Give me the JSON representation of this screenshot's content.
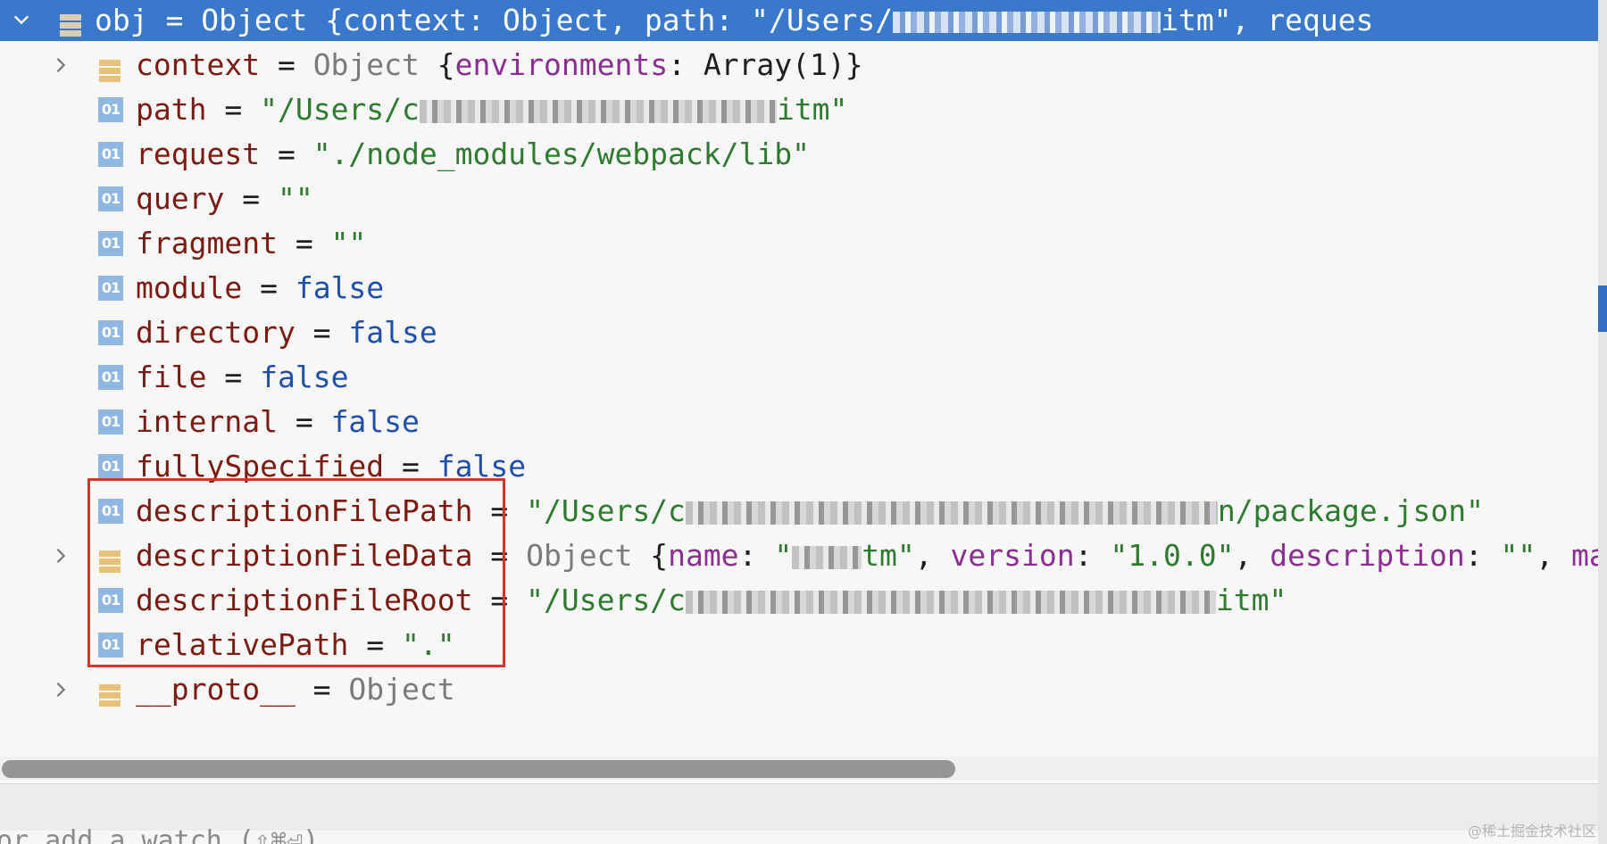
{
  "header": {
    "name": "obj",
    "eq": " = ",
    "type": "Object",
    "preview_start": " {context: Object, path: \"/Users/",
    "preview_end": "itm\", reques"
  },
  "rows": {
    "context": {
      "name": "context",
      "eq": " = ",
      "type": "Object",
      "preview_open": " {",
      "key": "environments",
      "rest": ": Array(1)}"
    },
    "path": {
      "name": "path",
      "eq": " = ",
      "value_start": "\"/Users/c",
      "value_end": "itm\""
    },
    "request": {
      "name": "request",
      "eq": " = ",
      "value": "\"./node_modules/webpack/lib\""
    },
    "query": {
      "name": "query",
      "eq": " = ",
      "value": "\"\""
    },
    "fragment": {
      "name": "fragment",
      "eq": " = ",
      "value": "\"\""
    },
    "module": {
      "name": "module",
      "eq": " = ",
      "value": "false"
    },
    "directory": {
      "name": "directory",
      "eq": " = ",
      "value": "false"
    },
    "file": {
      "name": "file",
      "eq": " = ",
      "value": "false"
    },
    "internal": {
      "name": "internal",
      "eq": " = ",
      "value": "false"
    },
    "fullySpecified": {
      "name": "fullySpecified",
      "eq": " = ",
      "value": "false"
    },
    "descriptionFilePath": {
      "name": "descriptionFilePath",
      "eq": " = ",
      "value_start": "\"/Users/c",
      "value_end": "n/package.json\""
    },
    "descriptionFileData": {
      "name": "descriptionFileData",
      "eq": " = ",
      "type": "Object",
      "open": " {",
      "k1": "name",
      "c1": ": ",
      "v1_start": "\"",
      "v1_end": "tm\"",
      "sep1": ", ",
      "k2": "version",
      "c2": ": ",
      "v2": "\"1.0.0\"",
      "sep2": ", ",
      "k3": "description",
      "c3": ": ",
      "v3": "\"\"",
      "sep3": ", ",
      "k4": "main"
    },
    "descriptionFileRoot": {
      "name": "descriptionFileRoot",
      "eq": " = ",
      "value_start": "\"/Users/c",
      "value_end": "itm\""
    },
    "relativePath": {
      "name": "relativePath",
      "eq": " = ",
      "value": "\".\""
    },
    "proto": {
      "name": "__proto__",
      "eq": " = ",
      "type": "Object"
    }
  },
  "icons": {
    "primitive_label": "01"
  },
  "footer": {
    "hint": "or add a watch (⇧⌘⏎)"
  },
  "watermark": "@稀土掘金技术社区",
  "colors": {
    "header_bg": "#3a78cc",
    "highlight_border": "#d9342b",
    "primitive_icon": "#8fb7e2",
    "object_icon": "#e8c27a"
  }
}
